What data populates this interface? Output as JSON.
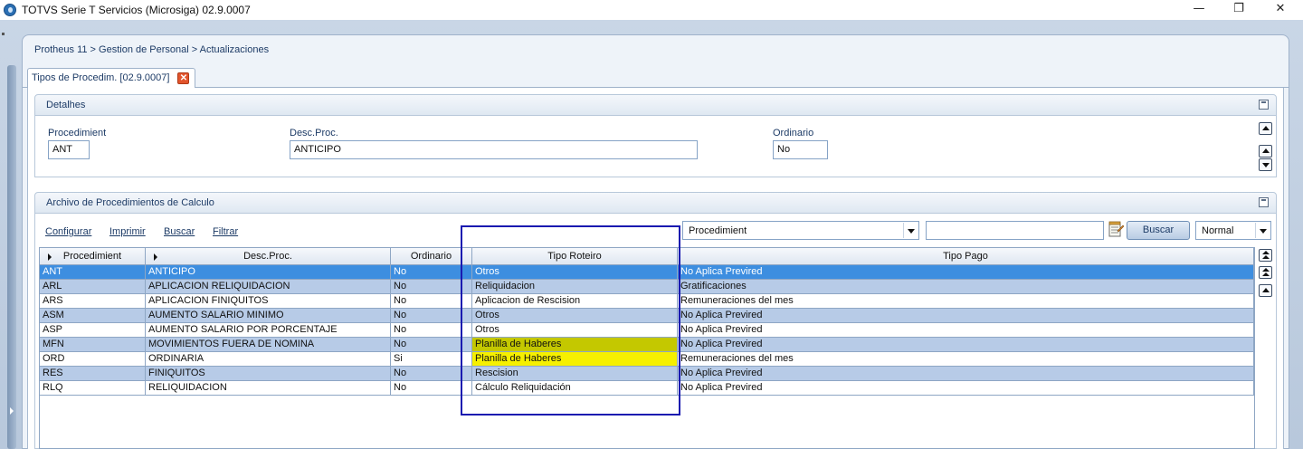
{
  "window": {
    "title": "TOTVS Serie T Servicios (Microsiga) 02.9.0007",
    "minimize_glyph": "—",
    "restore_glyph": "❐",
    "close_glyph": "✕"
  },
  "breadcrumb": "Protheus 11 > Gestion de Personal > Actualizaciones",
  "tab": {
    "label": "Tipos de Procedim. [02.9.0007]",
    "close_glyph": "✕"
  },
  "details": {
    "title": "Detalhes",
    "fields": [
      {
        "label": "Procedimient",
        "value": "ANT"
      },
      {
        "label": "Desc.Proc.",
        "value": "ANTICIPO"
      },
      {
        "label": "Ordinario",
        "value": "No"
      }
    ]
  },
  "archive": {
    "title": "Archivo de Procedimientos de Calculo",
    "toolbar": {
      "configurar": "Configurar",
      "imprimir": "Imprimir",
      "buscar_link": "Buscar",
      "filtrar": "Filtrar",
      "search_field_selected": "Procedimient",
      "search_value": "",
      "buscar_button": "Buscar",
      "view_mode": "Normal"
    },
    "columns": [
      "Procedimient",
      "Desc.Proc.",
      "Ordinario",
      "Tipo Roteiro",
      "Tipo Pago"
    ],
    "rows": [
      [
        "ANT",
        "ANTICIPO",
        "No",
        "Otros",
        "No Aplica Previred"
      ],
      [
        "ARL",
        "APLICACION RELIQUIDACION",
        "No",
        "Reliquidacion",
        " Gratificaciones"
      ],
      [
        "ARS",
        "APLICACION FINIQUITOS",
        "No",
        "Aplicacion de Rescision",
        "Remuneraciones del mes"
      ],
      [
        "ASM",
        "AUMENTO SALARIO MINIMO",
        "No",
        "Otros",
        "No Aplica Previred"
      ],
      [
        "ASP",
        "AUMENTO SALARIO POR PORCENTAJE",
        "No",
        "Otros",
        "No Aplica Previred"
      ],
      [
        "MFN",
        "MOVIMIENTOS FUERA DE NOMINA",
        "No",
        "Planilla de Haberes",
        "No Aplica Previred"
      ],
      [
        "ORD",
        "ORDINARIA",
        "Si",
        "Planilla de Haberes",
        "Remuneraciones del mes"
      ],
      [
        "RES",
        "FINIQUITOS",
        "No",
        "Rescision",
        "No Aplica Previred"
      ],
      [
        "RLQ",
        "RELIQUIDACION",
        "No",
        "Cálculo Reliquidación",
        "No Aplica Previred"
      ]
    ]
  },
  "colors": {
    "selected_row": "#3d8ee0",
    "alt_row": "#b7cbe7",
    "highlight_dark": "#c4c800",
    "highlight_bright": "#f6f000",
    "annotation_box": "#1a1ab0"
  }
}
